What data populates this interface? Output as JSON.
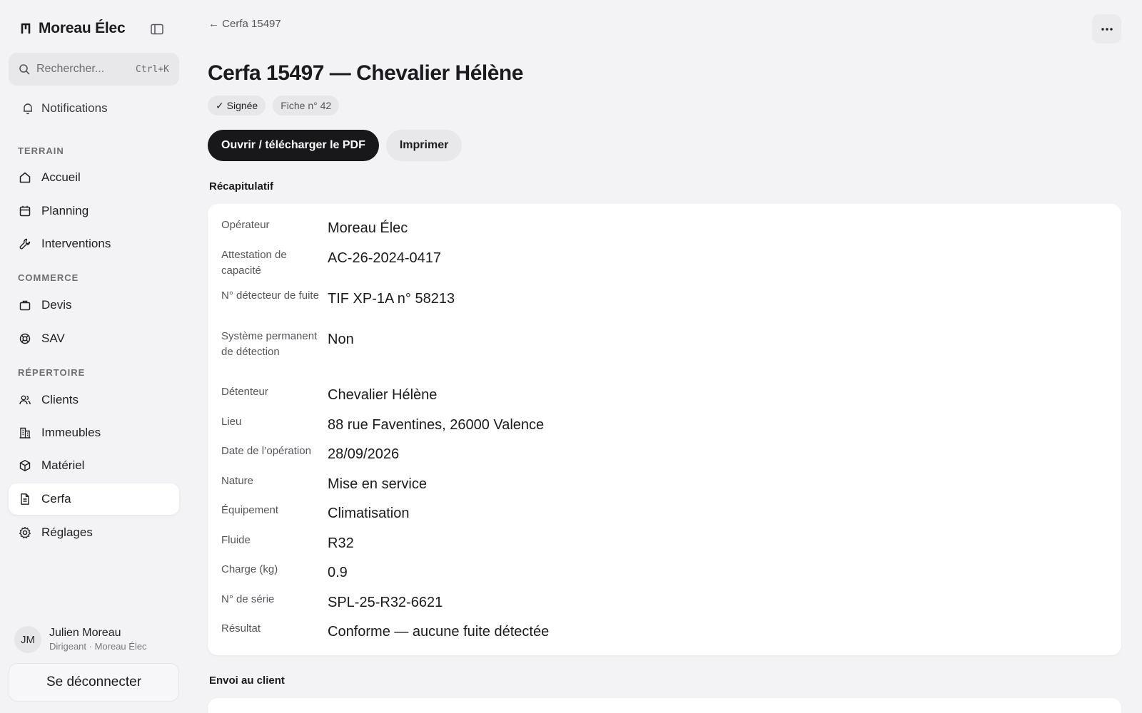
{
  "sidebar": {
    "brand": "Moreau Élec",
    "search": {
      "placeholder": "Rechercher...",
      "shortcut": "Ctrl+K"
    },
    "notifications": "Notifications",
    "sections": {
      "terrain": "TERRAIN",
      "commerce": "COMMERCE",
      "repertoire": "RÉPERTOIRE"
    },
    "items": {
      "accueil": "Accueil",
      "planning": "Planning",
      "interventions": "Interventions",
      "devis": "Devis",
      "sav": "SAV",
      "clients": "Clients",
      "immeubles": "Immeubles",
      "materiel": "Matériel",
      "cerfa": "Cerfa",
      "reglages": "Réglages"
    },
    "active_item": "cerfa",
    "user": {
      "initials": "JM",
      "name": "Julien Moreau",
      "role": "Dirigeant · Moreau Élec"
    },
    "logout": "Se déconnecter"
  },
  "main": {
    "back": "← Cerfa 15497",
    "title": "Cerfa 15497 — Chevalier Hélène",
    "badges": {
      "status": "✓ Signée",
      "fiche": "Fiche n° 42"
    },
    "actions": {
      "open_pdf": "Ouvrir / télécharger le PDF",
      "print": "Imprimer"
    },
    "summary_title": "Récapitulatif",
    "summary": [
      {
        "label": "Opérateur",
        "value": "Moreau Élec"
      },
      {
        "label": "Attestation de capacité",
        "value": "AC-26-2024-0417"
      },
      {
        "label": "N° détecteur de fuite",
        "value": "TIF XP-1A n° 58213"
      },
      {
        "label": "Système permanent de détection",
        "value": "Non"
      },
      {
        "label": "Détenteur",
        "value": "Chevalier Hélène"
      },
      {
        "label": "Lieu",
        "value": "88 rue Faventines, 26000 Valence"
      },
      {
        "label": "Date de l’opération",
        "value": "28/09/2026"
      },
      {
        "label": "Nature",
        "value": "Mise en service"
      },
      {
        "label": "Équipement",
        "value": "Climatisation"
      },
      {
        "label": "Fluide",
        "value": "R32"
      },
      {
        "label": "Charge (kg)",
        "value": "0.9"
      },
      {
        "label": "N° de série",
        "value": "SPL-25-R32-6621"
      },
      {
        "label": "Résultat",
        "value": "Conforme — aucune fuite détectée"
      }
    ],
    "send_title": "Envoi au client"
  }
}
